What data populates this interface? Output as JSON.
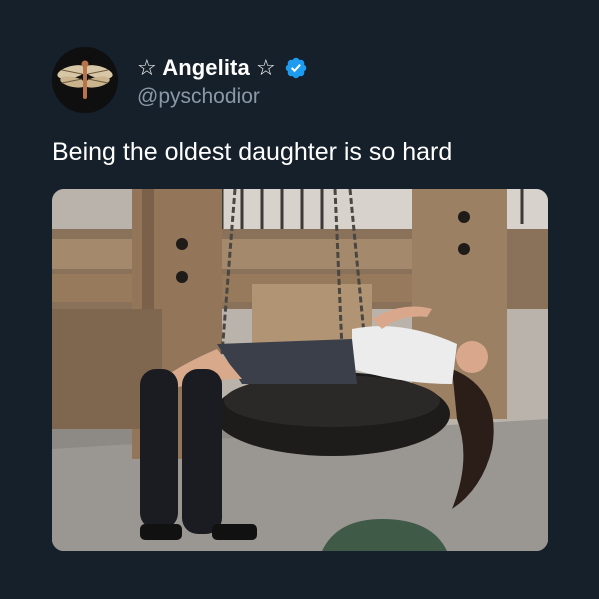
{
  "author": {
    "display_name": "☆ Angelita ☆",
    "handle": "@pyschodior",
    "avatar_icon": "dragonfly-icon",
    "verified_icon": "verified-badge-icon",
    "verified_color": "#1d9bf0"
  },
  "tweet": {
    "text": "Being the oldest daughter is so hard"
  },
  "media": {
    "kind": "photo"
  },
  "colors": {
    "background": "#15202b",
    "text_primary": "#ffffff",
    "text_secondary": "#8b98a5"
  }
}
